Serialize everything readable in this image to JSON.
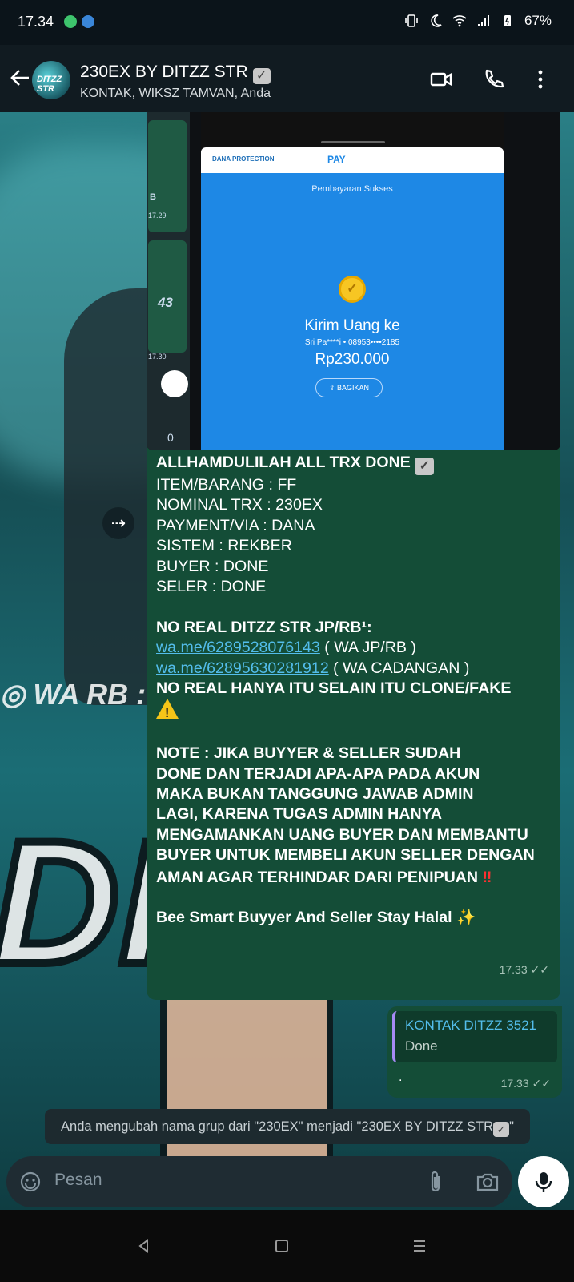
{
  "status_bar": {
    "time": "17.34",
    "battery": "67%"
  },
  "header": {
    "title": "230EX BY DITZZ STR",
    "subtitle": "KONTAK, WIKSZ TAMVAN, Anda",
    "avatar_text": "DITZZ STR"
  },
  "wallpaper": {
    "ig_text": "WA RB :",
    "big_text": "DI"
  },
  "screenshot": {
    "left_time1": "17.29",
    "left_time2": "17.30",
    "left_text1": "B",
    "left_text2": "43",
    "left_text3": "0",
    "dana_label": "DANA PROTECTION",
    "pay_label": "PAY",
    "status": "Pembayaran Sukses",
    "send_label": "Kirim Uang ke",
    "recipient": "Sri Pa****i • 08953••••2185",
    "amount": "Rp230.000",
    "share": "BAGIKAN"
  },
  "message": {
    "line_title": "ALLHAMDULILAH ALL TRX DONE",
    "item": "ITEM/BARANG : FF",
    "nominal": "NOMINAL TRX : 230EX",
    "payment": "PAYMENT/VIA : DANA",
    "sistem": "SISTEM : REKBER",
    "buyer": "BUYER : DONE",
    "seler": "SELER : DONE",
    "no_real": "NO REAL DITZZ STR JP/RB¹:",
    "link1": "wa.me/6289528076143",
    "link1_note": " ( WA JP/RB )",
    "link2": "wa.me/62895630281912",
    "link2_note": " ( WA CADANGAN )",
    "no_real_only": "NO REAL HANYA ITU SELAIN ITU CLONE/FAKE",
    "note1": "NOTE : JIKA BUYYER & SELLER SUDAH",
    "note2": "DONE DAN TERJADI APA-APA PADA AKUN",
    "note3": "MAKA BUKAN TANGGUNG JAWAB ADMIN",
    "note4": "LAGI, KARENA TUGAS ADMIN HANYA",
    "note5": "MENGAMANKAN UANG BUYER DAN MEMBANTU",
    "note6": "BUYER UNTUK MEMBELI AKUN SELLER DENGAN",
    "note7": "AMAN AGAR TERHINDAR DARI PENIPUAN",
    "closing": "Bee Smart Buyyer And Seller Stay Halal",
    "time": "17.33"
  },
  "reply": {
    "quoted_name": "KONTAK DITZZ 3521",
    "quoted_text": "Done",
    "text": ".",
    "time": "17.33"
  },
  "system_notice": "Anda mengubah nama grup dari \"230EX\" menjadi \"230EX BY DITZZ STR",
  "system_notice_end": "\"",
  "input": {
    "placeholder": "Pesan"
  },
  "colors": {
    "bubble": "#144d37",
    "link": "#53bdeb",
    "accent_bar": "#a68af5"
  }
}
